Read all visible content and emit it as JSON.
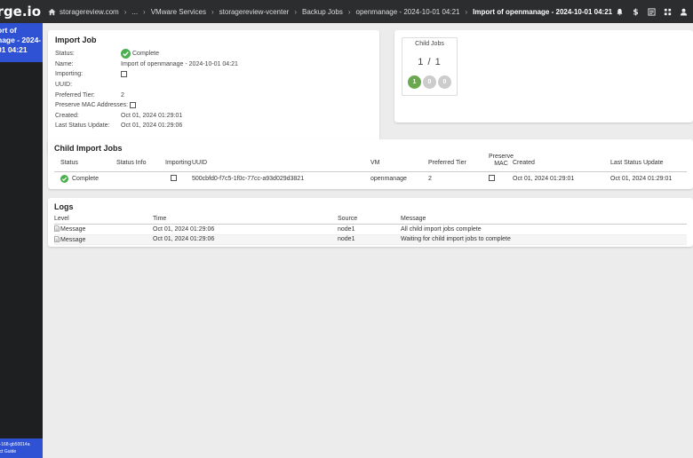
{
  "brand": {
    "text": "rge.io"
  },
  "breadcrumbs": [
    "storagereview.com",
    "...",
    "VMware Services",
    "storagereview-vcenter",
    "Backup Jobs",
    "openmanage - 2024-10-01 04:21",
    "Import of openmanage - 2024-10-01 04:21"
  ],
  "top_icons": [
    "bell-icon",
    "dollar-icon",
    "list-icon",
    "grid-icon",
    "user-icon"
  ],
  "sidebar": {
    "active_lines": [
      "ort of",
      "nage - 2024-",
      "01 04:21"
    ],
    "footer_lines": [
      "on-168-gb50014a",
      "duct Guide"
    ],
    "active_color": "#2f52d4"
  },
  "import_job": {
    "title": "Import Job",
    "fields": [
      {
        "label": "Status:",
        "value": "Complete"
      },
      {
        "label": "Name:",
        "value": "Import of openmanage - 2024-10-01 04:21"
      },
      {
        "label": "Importing:",
        "value": ""
      },
      {
        "label": "UUID:",
        "value": ""
      },
      {
        "label": "Preferred Tier:",
        "value": "2"
      },
      {
        "label": "Preserve MAC Addresses:",
        "value": ""
      },
      {
        "label": "Created:",
        "value": "Oct 01, 2024 01:29:01"
      },
      {
        "label": "Last Status Update:",
        "value": "Oct 01, 2024 01:29:06"
      }
    ]
  },
  "child_jobs": {
    "title": "Child Jobs",
    "count": "1 / 1",
    "badges": [
      {
        "value": "1",
        "color": "#6aa84f"
      },
      {
        "value": "0",
        "color": "#cccccc"
      },
      {
        "value": "0",
        "color": "#cccccc"
      }
    ]
  },
  "child_import_jobs": {
    "title": "Child Import Jobs",
    "headers": {
      "status": "Status",
      "status_info": "Status Info",
      "importing": "Importing",
      "uuid": "UUID",
      "vm": "VM",
      "preferred_tier": "Preferred Tier",
      "preserve_mac_1": "Preserve",
      "preserve_mac_2": "MAC",
      "created": "Created",
      "last_status_update": "Last Status Update"
    },
    "rows": [
      {
        "status": "Complete",
        "status_info": "",
        "uuid": "500cbfd0-f7c5-1f0c-77cc-a93d029d3821",
        "vm": "openmanage",
        "preferred_tier": "2",
        "created": "Oct 01, 2024 01:29:01",
        "last_status_update": "Oct 01, 2024 01:29:01"
      }
    ]
  },
  "logs": {
    "title": "Logs",
    "headers": {
      "level": "Level",
      "time": "Time",
      "source": "Source",
      "message": "Message"
    },
    "rows": [
      {
        "level": "Message",
        "time": "Oct 01, 2024 01:29:06",
        "source": "node1",
        "message": "All child import jobs complete"
      },
      {
        "level": "Message",
        "time": "Oct 01, 2024 01:29:06",
        "source": "node1",
        "message": "Waiting for child import jobs to complete"
      }
    ]
  },
  "colors": {
    "complete_green": "#4caf50",
    "topbar": "#2b2d2f",
    "background": "#ececec"
  }
}
